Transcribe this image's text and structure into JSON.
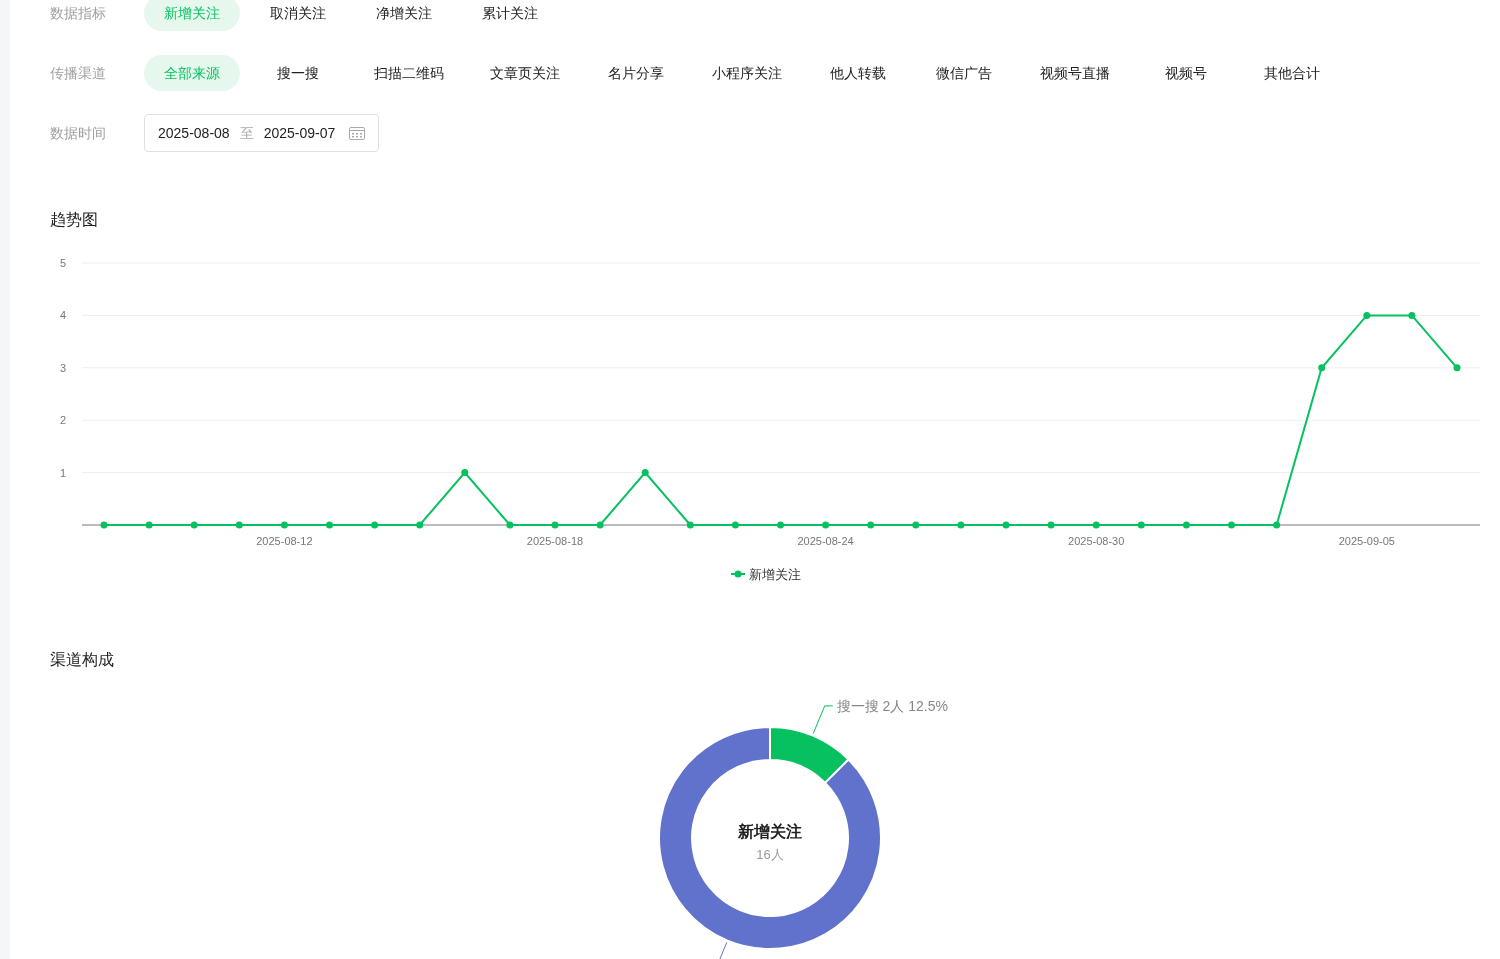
{
  "filters": [
    {
      "label": "数据指标",
      "options": [
        {
          "label": "新增关注",
          "selected": true
        },
        {
          "label": "取消关注",
          "selected": false
        },
        {
          "label": "净增关注",
          "selected": false
        },
        {
          "label": "累计关注",
          "selected": false
        }
      ]
    },
    {
      "label": "传播渠道",
      "options": [
        {
          "label": "全部来源",
          "selected": true
        },
        {
          "label": "搜一搜",
          "selected": false
        },
        {
          "label": "扫描二维码",
          "selected": false
        },
        {
          "label": "文章页关注",
          "selected": false
        },
        {
          "label": "名片分享",
          "selected": false
        },
        {
          "label": "小程序关注",
          "selected": false
        },
        {
          "label": "他人转载",
          "selected": false
        },
        {
          "label": "微信广告",
          "selected": false
        },
        {
          "label": "视频号直播",
          "selected": false
        },
        {
          "label": "视频号",
          "selected": false
        },
        {
          "label": "其他合计",
          "selected": false
        }
      ]
    }
  ],
  "date_range": {
    "label": "数据时间",
    "start": "2025-08-08",
    "separator": "至",
    "end": "2025-09-07"
  },
  "trend": {
    "title": "趋势图",
    "chart_data": {
      "type": "line",
      "x": [
        null,
        null,
        null,
        null,
        "2025-08-12",
        null,
        null,
        null,
        null,
        null,
        "2025-08-18",
        null,
        null,
        null,
        null,
        null,
        "2025-08-24",
        null,
        null,
        null,
        null,
        null,
        "2025-08-30",
        null,
        null,
        null,
        null,
        null,
        "2025-09-05",
        null,
        null
      ],
      "grid": true,
      "series": [
        {
          "name": "新增关注",
          "color": "#07c160",
          "marker": "circle",
          "values": [
            0,
            0,
            0,
            0,
            0,
            0,
            0,
            0,
            1,
            0,
            0,
            0,
            1,
            0,
            0,
            0,
            0,
            0,
            0,
            0,
            0,
            0,
            0,
            0,
            0,
            0,
            0,
            3,
            4,
            4,
            3
          ]
        }
      ],
      "ylim": [
        0,
        5
      ],
      "yticks": [
        {
          "value": 1,
          "label": "1"
        },
        {
          "value": 2,
          "label": "2"
        },
        {
          "value": 3,
          "label": "3"
        },
        {
          "value": 4,
          "label": "4"
        },
        {
          "value": 5,
          "label": "5"
        }
      ]
    }
  },
  "channels": {
    "title": "渠道构成",
    "center_value": "16人",
    "slice_labels": [
      {
        "count": "2人",
        "percent": "12.5%"
      }
    ],
    "chart_data": {
      "type": "donut",
      "categories": [
        "搜一搜",
        null
      ],
      "series": [
        {
          "name": "新增关注",
          "values": [
            12.5,
            87.5
          ]
        }
      ],
      "colors": [
        "#07c160",
        "#6172cc"
      ]
    }
  }
}
